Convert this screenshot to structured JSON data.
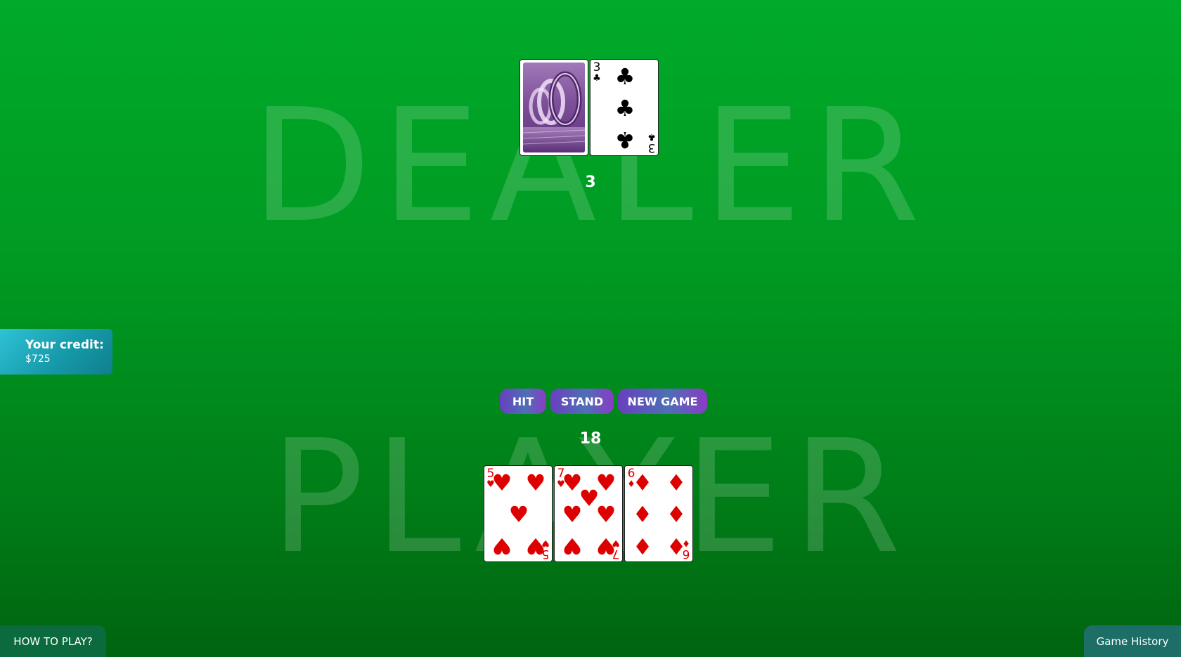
{
  "table": {
    "dealer_label": "DEALER",
    "player_label": "PLAYER"
  },
  "dealer": {
    "score": "3",
    "cards": [
      {
        "face_down": true
      },
      {
        "rank": "3",
        "suit": "♣",
        "color": "black"
      }
    ]
  },
  "player": {
    "score": "18",
    "cards": [
      {
        "rank": "5",
        "suit": "♥",
        "color": "red"
      },
      {
        "rank": "7",
        "suit": "♥",
        "color": "red"
      },
      {
        "rank": "6",
        "suit": "♦",
        "color": "red"
      }
    ]
  },
  "controls": {
    "hit_label": "HIT",
    "stand_label": "STAND",
    "new_game_label": "NEW GAME"
  },
  "credit": {
    "label": "Your credit:",
    "value": "$725"
  },
  "footer": {
    "how_to_play": "HOW TO PLAY?",
    "history": "Game History"
  },
  "colors": {
    "red_suit": "#dd0000",
    "black_suit": "#000000",
    "table_green": "#00aa2a"
  }
}
